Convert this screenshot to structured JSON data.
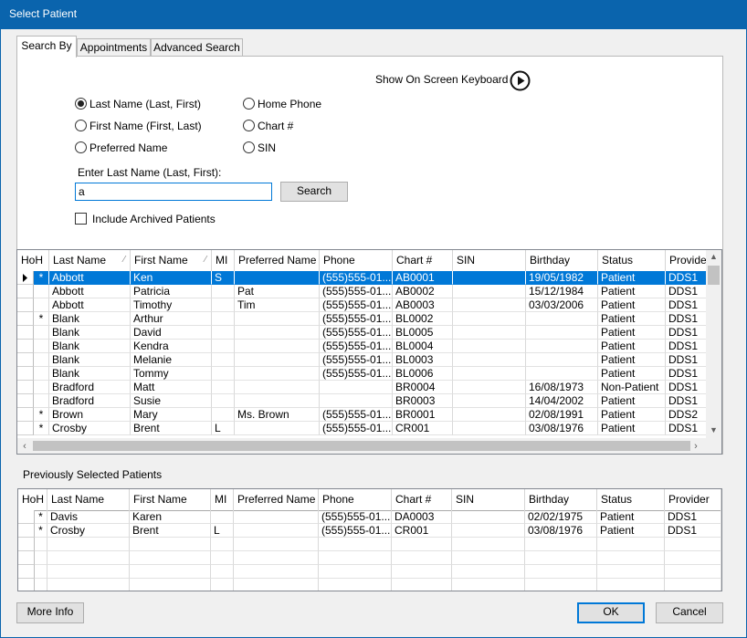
{
  "window": {
    "title": "Select Patient"
  },
  "tabs": [
    {
      "label": "Search By",
      "active": true
    },
    {
      "label": "Appointments",
      "active": false
    },
    {
      "label": "Advanced Search",
      "active": false
    }
  ],
  "keyboard": {
    "label": "Show On Screen Keyboard",
    "icon": "play-circle-icon"
  },
  "radios": {
    "last_name": {
      "label": "Last Name (Last, First)",
      "checked": true
    },
    "first_name": {
      "label": "First Name (First, Last)",
      "checked": false
    },
    "preferred": {
      "label": "Preferred Name",
      "checked": false
    },
    "home_phone": {
      "label": "Home Phone",
      "checked": false
    },
    "chart": {
      "label": "Chart #",
      "checked": false
    },
    "sin": {
      "label": "SIN",
      "checked": false
    }
  },
  "search": {
    "label": "Enter Last Name (Last, First):",
    "value": "a",
    "button": "Search"
  },
  "archived": {
    "label": "Include Archived Patients",
    "checked": false
  },
  "columns": [
    "HoH",
    "Last Name",
    "First Name",
    "MI",
    "Preferred Name",
    "Phone",
    "Chart #",
    "SIN",
    "Birthday",
    "Status",
    "Provider"
  ],
  "results": [
    {
      "hoh": "*",
      "last": "Abbott",
      "first": "Ken",
      "mi": "S",
      "pref": "",
      "phone": "(555)555-01...",
      "chart": "AB0001",
      "sin": "",
      "bday": "19/05/1982",
      "status": "Patient",
      "prov": "DDS1"
    },
    {
      "hoh": "",
      "last": "Abbott",
      "first": "Patricia",
      "mi": "",
      "pref": "Pat",
      "phone": "(555)555-01...",
      "chart": "AB0002",
      "sin": "",
      "bday": "15/12/1984",
      "status": "Patient",
      "prov": "DDS1"
    },
    {
      "hoh": "",
      "last": "Abbott",
      "first": "Timothy",
      "mi": "",
      "pref": "Tim",
      "phone": "(555)555-01...",
      "chart": "AB0003",
      "sin": "",
      "bday": "03/03/2006",
      "status": "Patient",
      "prov": "DDS1"
    },
    {
      "hoh": "*",
      "last": "Blank",
      "first": "Arthur",
      "mi": "",
      "pref": "",
      "phone": "(555)555-01...",
      "chart": "BL0002",
      "sin": "",
      "bday": "",
      "status": "Patient",
      "prov": "DDS1"
    },
    {
      "hoh": "",
      "last": "Blank",
      "first": "David",
      "mi": "",
      "pref": "",
      "phone": "(555)555-01...",
      "chart": "BL0005",
      "sin": "",
      "bday": "",
      "status": "Patient",
      "prov": "DDS1"
    },
    {
      "hoh": "",
      "last": "Blank",
      "first": "Kendra",
      "mi": "",
      "pref": "",
      "phone": "(555)555-01...",
      "chart": "BL0004",
      "sin": "",
      "bday": "",
      "status": "Patient",
      "prov": "DDS1"
    },
    {
      "hoh": "",
      "last": "Blank",
      "first": "Melanie",
      "mi": "",
      "pref": "",
      "phone": "(555)555-01...",
      "chart": "BL0003",
      "sin": "",
      "bday": "",
      "status": "Patient",
      "prov": "DDS1"
    },
    {
      "hoh": "",
      "last": "Blank",
      "first": "Tommy",
      "mi": "",
      "pref": "",
      "phone": "(555)555-01...",
      "chart": "BL0006",
      "sin": "",
      "bday": "",
      "status": "Patient",
      "prov": "DDS1"
    },
    {
      "hoh": "",
      "last": "Bradford",
      "first": "Matt",
      "mi": "",
      "pref": "",
      "phone": "",
      "chart": "BR0004",
      "sin": "",
      "bday": "16/08/1973",
      "status": "Non-Patient",
      "prov": "DDS1"
    },
    {
      "hoh": "",
      "last": "Bradford",
      "first": "Susie",
      "mi": "",
      "pref": "",
      "phone": "",
      "chart": "BR0003",
      "sin": "",
      "bday": "14/04/2002",
      "status": "Patient",
      "prov": "DDS1"
    },
    {
      "hoh": "*",
      "last": "Brown",
      "first": "Mary",
      "mi": "",
      "pref": "Ms. Brown",
      "phone": "(555)555-01...",
      "chart": "BR0001",
      "sin": "",
      "bday": "02/08/1991",
      "status": "Patient",
      "prov": "DDS2"
    },
    {
      "hoh": "*",
      "last": "Crosby",
      "first": "Brent",
      "mi": "L",
      "pref": "",
      "phone": "(555)555-01...",
      "chart": "CR001",
      "sin": "",
      "bday": "03/08/1976",
      "status": "Patient",
      "prov": "DDS1"
    }
  ],
  "previous": {
    "label": "Previously Selected Patients",
    "rows": [
      {
        "hoh": "*",
        "last": "Davis",
        "first": "Karen",
        "mi": "",
        "pref": "",
        "phone": "(555)555-01...",
        "chart": "DA0003",
        "sin": "",
        "bday": "02/02/1975",
        "status": "Patient",
        "prov": "DDS1"
      },
      {
        "hoh": "*",
        "last": "Crosby",
        "first": "Brent",
        "mi": "L",
        "pref": "",
        "phone": "(555)555-01...",
        "chart": "CR001",
        "sin": "",
        "bday": "03/08/1976",
        "status": "Patient",
        "prov": "DDS1"
      }
    ]
  },
  "buttons": {
    "more_info": "More Info",
    "ok": "OK",
    "cancel": "Cancel"
  }
}
